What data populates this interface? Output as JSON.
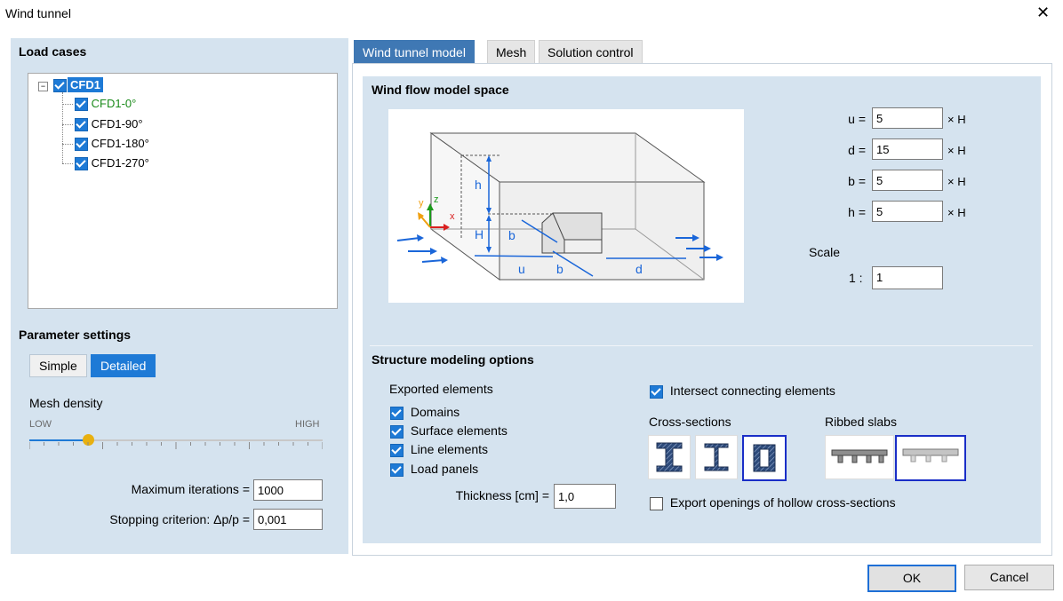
{
  "window": {
    "title": "Wind tunnel",
    "close_glyph": "✕"
  },
  "load_cases": {
    "title": "Load cases",
    "root": {
      "label": "CFD1",
      "checked": true
    },
    "children": [
      {
        "label": "CFD1-0°",
        "checked": true,
        "color": "#1a8a1a"
      },
      {
        "label": "CFD1-90°",
        "checked": true
      },
      {
        "label": "CFD1-180°",
        "checked": true
      },
      {
        "label": "CFD1-270°",
        "checked": true
      }
    ]
  },
  "parameter_settings": {
    "title": "Parameter settings",
    "modes": [
      "Simple",
      "Detailed"
    ],
    "active_mode": "Detailed",
    "mesh_density_label": "Mesh density",
    "low_label": "LOW",
    "high_label": "HIGH",
    "mesh_density_value": 0.2,
    "max_iterations_label": "Maximum iterations =",
    "max_iterations_value": "1000",
    "stopping_label": "Stopping criterion: Δp/p =",
    "stopping_value": "0,001"
  },
  "tabs": [
    {
      "label": "Wind tunnel model",
      "active": true
    },
    {
      "label": "Mesh",
      "active": false
    },
    {
      "label": "Solution control",
      "active": false
    }
  ],
  "wind_flow": {
    "title": "Wind flow model space",
    "params": [
      {
        "label": "u =",
        "value": "5",
        "unit": "× H"
      },
      {
        "label": "d =",
        "value": "15",
        "unit": "× H"
      },
      {
        "label": "b =",
        "value": "5",
        "unit": "× H"
      },
      {
        "label": "h =",
        "value": "5",
        "unit": "× H"
      }
    ],
    "scale_label": "Scale",
    "scale_prefix": "1 :",
    "scale_value": "1",
    "diagram_labels": {
      "h": "h",
      "H": "H",
      "b1": "b",
      "b2": "b",
      "u": "u",
      "d": "d",
      "z": "z",
      "y": "y",
      "x": "x"
    }
  },
  "structure": {
    "title": "Structure modeling options",
    "exported_label": "Exported elements",
    "exported": [
      {
        "label": "Domains",
        "checked": true
      },
      {
        "label": "Surface elements",
        "checked": true
      },
      {
        "label": "Line elements",
        "checked": true
      },
      {
        "label": "Load panels",
        "checked": true
      }
    ],
    "thickness_label": "Thickness [cm] =",
    "thickness_value": "1,0",
    "intersect_label": "Intersect connecting elements",
    "intersect_checked": true,
    "cross_sections_label": "Cross-sections",
    "ribbed_label": "Ribbed slabs",
    "export_openings_label": "Export openings of hollow cross-sections",
    "export_openings_checked": false
  },
  "buttons": {
    "ok": "OK",
    "cancel": "Cancel"
  },
  "colors": {
    "accent": "#1e7ad6",
    "tab_active": "#3f78b4",
    "panel": "#d5e3ef",
    "selection": "#1a2ec7",
    "slider_thumb": "#e8b010"
  }
}
